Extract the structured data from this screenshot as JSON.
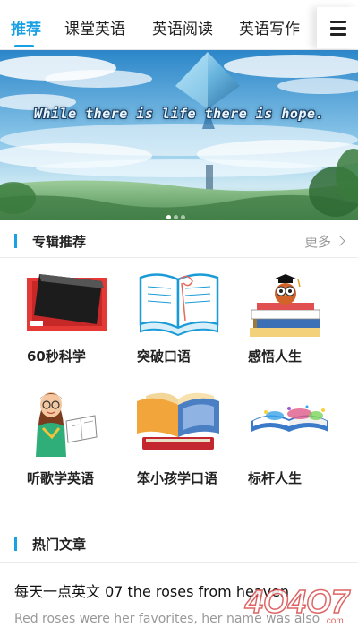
{
  "tabs": [
    {
      "label": "推荐",
      "active": true
    },
    {
      "label": "课堂英语",
      "active": false
    },
    {
      "label": "英语阅读",
      "active": false
    },
    {
      "label": "英语写作",
      "active": false
    }
  ],
  "menu_icon": "hamburger-menu-icon",
  "banner": {
    "caption": "While there is life there is hope.",
    "slide_count": 3,
    "active_slide": 1
  },
  "albums_section": {
    "title": "专辑推荐",
    "more_label": "更多"
  },
  "albums": [
    {
      "label": "60秒科学",
      "icon": "black-book-icon"
    },
    {
      "label": "突破口语",
      "icon": "open-book-icon"
    },
    {
      "label": "感悟人生",
      "icon": "owl-on-books-icon"
    },
    {
      "label": "听歌学英语",
      "icon": "teacher-reading-icon"
    },
    {
      "label": "笨小孩学口语",
      "icon": "stacked-books-icon"
    },
    {
      "label": "标杆人生",
      "icon": "open-magic-book-icon"
    }
  ],
  "articles_section": {
    "title": "热门文章"
  },
  "article": {
    "title": "每天一点英文 07 the roses from heaven",
    "excerpt": "Red roses were her favorites, her name was also"
  },
  "watermark_text": "4O4O7.com",
  "colors": {
    "accent": "#1aa1e4",
    "text": "#222222",
    "muted": "#999999"
  }
}
